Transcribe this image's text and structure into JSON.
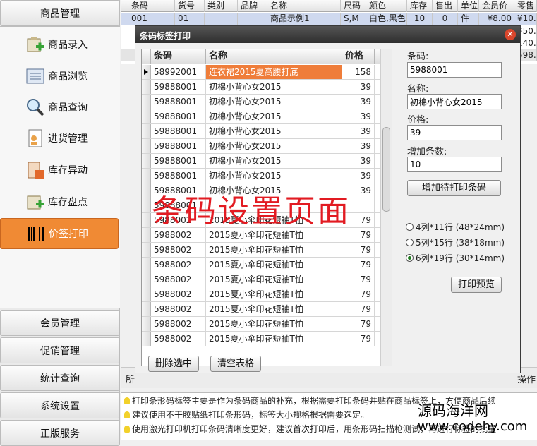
{
  "sidebar": {
    "top_group": "商品管理",
    "items": [
      {
        "label": "商品录入",
        "icon": "add-item-icon"
      },
      {
        "label": "商品浏览",
        "icon": "browse-list-icon"
      },
      {
        "label": "商品查询",
        "icon": "search-icon"
      },
      {
        "label": "进货管理",
        "icon": "purchase-doc-icon"
      },
      {
        "label": "库存异动",
        "icon": "stock-change-icon"
      },
      {
        "label": "库存盘点",
        "icon": "stock-count-icon"
      },
      {
        "label": "价签打印",
        "icon": "barcode-icon",
        "active": true
      }
    ],
    "bottom_groups": [
      "会员管理",
      "促销管理",
      "统计查询",
      "系统设置",
      "正版服务"
    ]
  },
  "background_grid": {
    "headers": [
      "条码",
      "货号",
      "类别",
      "品牌",
      "名称",
      "尺码",
      "颜色",
      "库存",
      "售出",
      "单位",
      "会员价",
      "零售"
    ],
    "row1": [
      "001",
      "01",
      "",
      "",
      "商品示例1",
      "S,M",
      "白色,黑色",
      "10",
      "0",
      "件",
      "¥8.00",
      "¥10."
    ],
    "row2_right": "¥50.",
    "row3_right": "140.",
    "row4_right": "598."
  },
  "dialog": {
    "title": "条码标签打印",
    "close_glyph": "✕",
    "grid": {
      "headers": {
        "code": "条码",
        "name": "名称",
        "price": "价格"
      },
      "rows": [
        {
          "code": "58992001",
          "name": "连衣裙2015夏高腰打底",
          "price": "158"
        },
        {
          "code": "59888001",
          "name": "初棉小背心女2015",
          "price": "39"
        },
        {
          "code": "59888001",
          "name": "初棉小背心女2015",
          "price": "39"
        },
        {
          "code": "59888001",
          "name": "初棉小背心女2015",
          "price": "39"
        },
        {
          "code": "59888001",
          "name": "初棉小背心女2015",
          "price": "39"
        },
        {
          "code": "59888001",
          "name": "初棉小背心女2015",
          "price": "39"
        },
        {
          "code": "59888001",
          "name": "初棉小背心女2015",
          "price": "39"
        },
        {
          "code": "59888001",
          "name": "初棉小背心女2015",
          "price": "39"
        },
        {
          "code": "59888001",
          "name": "初棉小背心女2015",
          "price": "39"
        },
        {
          "code": "59888001",
          "name": "",
          "price": ""
        },
        {
          "code": "5988002",
          "name": "2015夏小伞印花短袖T恤",
          "price": "79"
        },
        {
          "code": "5988002",
          "name": "2015夏小伞印花短袖T恤",
          "price": "79"
        },
        {
          "code": "5988002",
          "name": "2015夏小伞印花短袖T恤",
          "price": "79"
        },
        {
          "code": "5988002",
          "name": "2015夏小伞印花短袖T恤",
          "price": "79"
        },
        {
          "code": "5988002",
          "name": "2015夏小伞印花短袖T恤",
          "price": "79"
        },
        {
          "code": "5988002",
          "name": "2015夏小伞印花短袖T恤",
          "price": "79"
        },
        {
          "code": "5988002",
          "name": "2015夏小伞印花短袖T恤",
          "price": "79"
        },
        {
          "code": "5988002",
          "name": "2015夏小伞印花短袖T恤",
          "price": "79"
        },
        {
          "code": "5988002",
          "name": "2015夏小伞印花短袖T恤",
          "price": "79"
        }
      ]
    },
    "delete_button": "删除选中",
    "clear_button": "清空表格",
    "barcode_label": "条码:",
    "barcode_value": "5988001",
    "name_label": "名称:",
    "name_value": "初棉小背心女2015",
    "price_label": "价格:",
    "price_value": "39",
    "count_label": "增加条数:",
    "count_value": "10",
    "add_button": "增加待打印条码",
    "layouts": [
      {
        "label": "4列*11行 (48*24mm)",
        "checked": false
      },
      {
        "label": "5列*15行 (38*18mm)",
        "checked": false
      },
      {
        "label": "6列*19行 (30*14mm)",
        "checked": true
      }
    ],
    "preview_button": "打印预览"
  },
  "overlay_caption": "条码设置页面",
  "bottom_strip": {
    "left": "所",
    "right": "操作"
  },
  "tips": [
    "打印条形码标签主要是作为条码商品的补充，根据需要打印条码并贴在商品标签上，方便商品后续",
    "建议使用不干胶贴纸打印条形码，标签大小规格根据需要选定。",
    "使用激光打印机打印条码清晰度更好，建议首次打印后，用条形码扫描枪测试，再进行标签的批量"
  ],
  "watermark": {
    "site": "源码海洋网",
    "url": "www.codehy.com"
  },
  "colors": {
    "accent_orange": "#f08a34",
    "selected_cell": "#ef7d3a",
    "caption_red": "#e21b22",
    "titlebar": "#3a3a3a"
  }
}
